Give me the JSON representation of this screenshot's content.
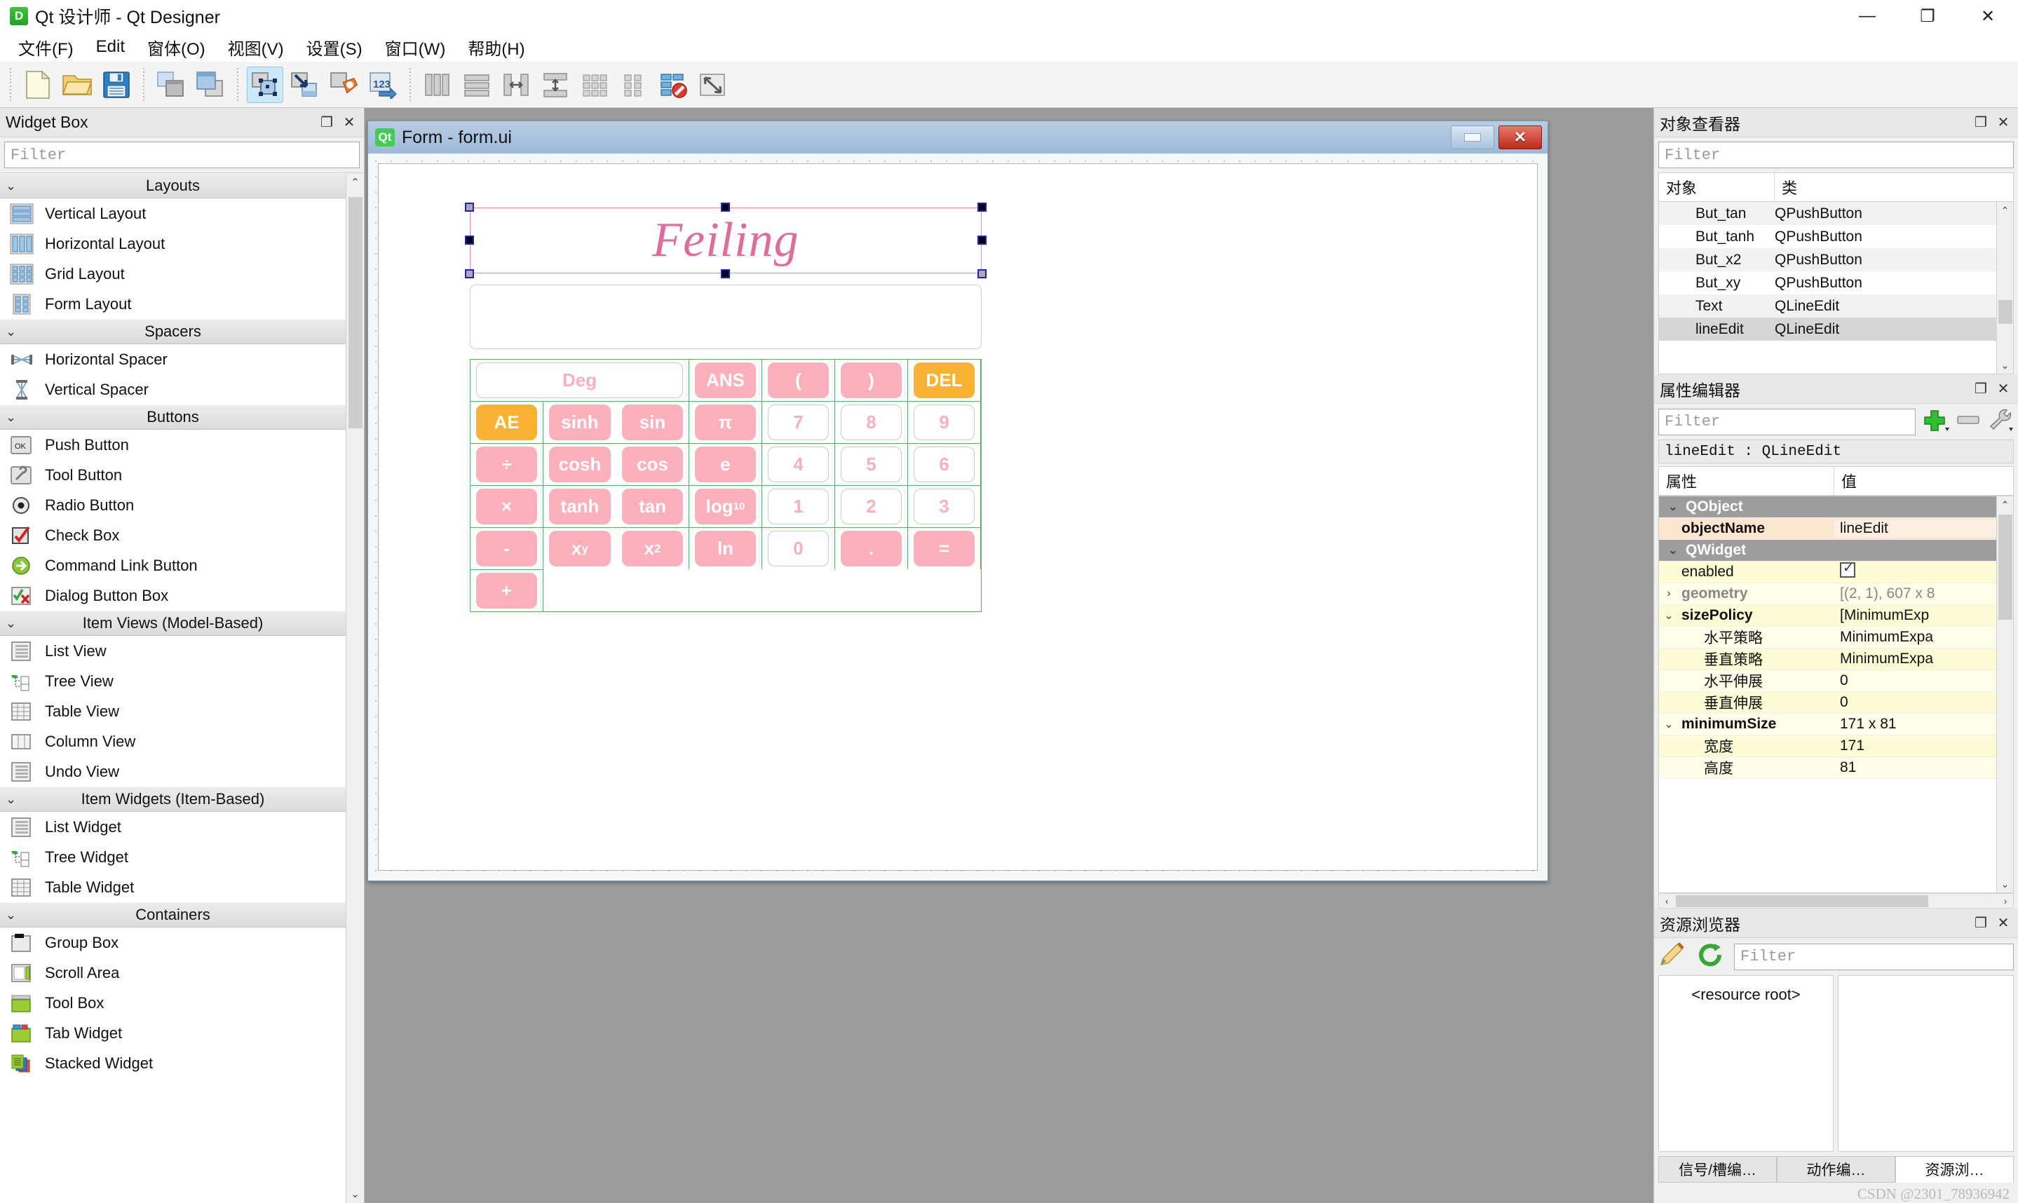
{
  "window": {
    "app_icon_letter": "D",
    "title": "Qt 设计师 - Qt Designer",
    "min_label": "—",
    "max_label": "❐",
    "close_label": "✕"
  },
  "menubar": {
    "items": [
      {
        "label": "文件(F)"
      },
      {
        "label": "Edit"
      },
      {
        "label": "窗体(O)"
      },
      {
        "label": "视图(V)"
      },
      {
        "label": "设置(S)"
      },
      {
        "label": "窗口(W)"
      },
      {
        "label": "帮助(H)"
      }
    ]
  },
  "toolbar": {
    "groups": [
      [
        "new-file-icon",
        "open-folder-icon",
        "save-disk-icon"
      ],
      [
        "copy-windows-icon",
        "paste-windows-icon"
      ],
      [
        "edit-widgets-icon",
        "edit-signals-slots-icon",
        "edit-buddies-icon",
        "edit-tab-order-icon"
      ],
      [
        "layout-horizontally-icon",
        "layout-vertically-icon",
        "layout-splitter-h-icon",
        "layout-splitter-v-icon",
        "layout-grid-icon",
        "layout-form-icon",
        "break-layout-icon",
        "adjust-size-icon"
      ]
    ]
  },
  "widget_box": {
    "title": "Widget Box",
    "float_label": "❐",
    "close_label": "✕",
    "filter_placeholder": "Filter",
    "scroll_up": "⌃",
    "scroll_down": "⌄",
    "categories": [
      {
        "name": "Layouts",
        "chevron": "⌄",
        "items": [
          {
            "label": "Vertical Layout",
            "icon": "vertical-layout-icon"
          },
          {
            "label": "Horizontal Layout",
            "icon": "horizontal-layout-icon"
          },
          {
            "label": "Grid Layout",
            "icon": "grid-layout-icon"
          },
          {
            "label": "Form Layout",
            "icon": "form-layout-icon"
          }
        ]
      },
      {
        "name": "Spacers",
        "chevron": "⌄",
        "items": [
          {
            "label": "Horizontal Spacer",
            "icon": "horizontal-spacer-icon"
          },
          {
            "label": "Vertical Spacer",
            "icon": "vertical-spacer-icon"
          }
        ]
      },
      {
        "name": "Buttons",
        "chevron": "⌄",
        "items": [
          {
            "label": "Push Button",
            "icon": "push-button-icon"
          },
          {
            "label": "Tool Button",
            "icon": "tool-button-icon"
          },
          {
            "label": "Radio Button",
            "icon": "radio-button-icon"
          },
          {
            "label": "Check Box",
            "icon": "check-box-icon"
          },
          {
            "label": "Command Link Button",
            "icon": "command-link-button-icon"
          },
          {
            "label": "Dialog Button Box",
            "icon": "dialog-button-box-icon"
          }
        ]
      },
      {
        "name": "Item Views (Model-Based)",
        "chevron": "⌄",
        "items": [
          {
            "label": "List View",
            "icon": "list-view-icon"
          },
          {
            "label": "Tree View",
            "icon": "tree-view-icon"
          },
          {
            "label": "Table View",
            "icon": "table-view-icon"
          },
          {
            "label": "Column View",
            "icon": "column-view-icon"
          },
          {
            "label": "Undo View",
            "icon": "undo-view-icon"
          }
        ]
      },
      {
        "name": "Item Widgets (Item-Based)",
        "chevron": "⌄",
        "items": [
          {
            "label": "List Widget",
            "icon": "list-widget-icon"
          },
          {
            "label": "Tree Widget",
            "icon": "tree-widget-icon"
          },
          {
            "label": "Table Widget",
            "icon": "table-widget-icon"
          }
        ]
      },
      {
        "name": "Containers",
        "chevron": "⌄",
        "items": [
          {
            "label": "Group Box",
            "icon": "group-box-icon"
          },
          {
            "label": "Scroll Area",
            "icon": "scroll-area-icon"
          },
          {
            "label": "Tool Box",
            "icon": "tool-box-icon"
          },
          {
            "label": "Tab Widget",
            "icon": "tab-widget-icon"
          },
          {
            "label": "Stacked Widget",
            "icon": "stacked-widget-icon"
          }
        ]
      }
    ]
  },
  "form_window": {
    "badge": "Qt",
    "title": "Form - form.ui",
    "minimize_label": "",
    "close_label": "✕"
  },
  "calculator": {
    "brand": "Feiling",
    "display_value": "",
    "rows": [
      [
        {
          "label": "Deg",
          "style": "white",
          "span": 3
        },
        {
          "label": "ANS",
          "style": "pink"
        },
        {
          "label": "(",
          "style": "pink"
        },
        {
          "label": ")",
          "style": "pink"
        },
        {
          "label": "DEL",
          "style": "orange"
        },
        {
          "label": "AE",
          "style": "orange"
        }
      ],
      [
        {
          "label": "sinh",
          "style": "pink"
        },
        {
          "label": "sin",
          "style": "pink"
        },
        {
          "label": "π",
          "style": "pink"
        },
        {
          "label": "7",
          "style": "white"
        },
        {
          "label": "8",
          "style": "white"
        },
        {
          "label": "9",
          "style": "white"
        },
        {
          "label": "÷",
          "style": "pink"
        }
      ],
      [
        {
          "label": "cosh",
          "style": "pink"
        },
        {
          "label": "cos",
          "style": "pink"
        },
        {
          "label": "e",
          "style": "pink"
        },
        {
          "label": "4",
          "style": "white"
        },
        {
          "label": "5",
          "style": "white"
        },
        {
          "label": "6",
          "style": "white"
        },
        {
          "label": "×",
          "style": "pink"
        }
      ],
      [
        {
          "label": "tanh",
          "style": "pink"
        },
        {
          "label": "tan",
          "style": "pink"
        },
        {
          "label": "log",
          "sub": "10",
          "style": "pink"
        },
        {
          "label": "1",
          "style": "white"
        },
        {
          "label": "2",
          "style": "white"
        },
        {
          "label": "3",
          "style": "white"
        },
        {
          "label": "-",
          "style": "pink"
        }
      ],
      [
        {
          "label": "x",
          "sup": "y",
          "style": "pink"
        },
        {
          "label": "x",
          "sup": "2",
          "style": "pink"
        },
        {
          "label": "ln",
          "style": "pink"
        },
        {
          "label": "0",
          "style": "white"
        },
        {
          "label": ".",
          "style": "pink"
        },
        {
          "label": "=",
          "style": "pink"
        },
        {
          "label": "+",
          "style": "pink"
        }
      ]
    ]
  },
  "object_inspector": {
    "title": "对象查看器",
    "float_label": "❐",
    "close_label": "✕",
    "filter_placeholder": "Filter",
    "columns": [
      "对象",
      "类"
    ],
    "rows": [
      {
        "object": "But_tan",
        "class": "QPushButton"
      },
      {
        "object": "But_tanh",
        "class": "QPushButton"
      },
      {
        "object": "But_x2",
        "class": "QPushButton"
      },
      {
        "object": "But_xy",
        "class": "QPushButton"
      },
      {
        "object": "Text",
        "class": "QLineEdit"
      },
      {
        "object": "lineEdit",
        "class": "QLineEdit"
      }
    ],
    "selected_index": 5,
    "scroll_up": "⌃",
    "scroll_down": "⌄"
  },
  "property_editor": {
    "title": "属性编辑器",
    "float_label": "❐",
    "close_label": "✕",
    "filter_placeholder": "Filter",
    "add_icon": "plus-icon",
    "remove_icon": "minus-icon",
    "configure_icon": "wrench-icon",
    "object_line": "lineEdit : QLineEdit",
    "columns": [
      "属性",
      "值"
    ],
    "rows": [
      {
        "kind": "group",
        "name": "QObject",
        "value": "",
        "chevron": "⌄"
      },
      {
        "kind": "name",
        "name": "objectName",
        "value": "lineEdit",
        "indent": 1
      },
      {
        "kind": "group",
        "name": "QWidget",
        "value": "",
        "chevron": "⌄"
      },
      {
        "kind": "y",
        "name": "enabled",
        "value": "",
        "indent": 1,
        "checkbox": true
      },
      {
        "kind": "y2",
        "name": "geometry",
        "value": "[(2, 1), 607 x 8",
        "chevron": "›",
        "bold": true,
        "dim": true
      },
      {
        "kind": "y",
        "name": "sizePolicy",
        "value": "[MinimumExp",
        "chevron": "⌄",
        "bold": true
      },
      {
        "kind": "y2",
        "name": "水平策略",
        "value": "MinimumExpa",
        "indent": 2
      },
      {
        "kind": "y",
        "name": "垂直策略",
        "value": "MinimumExpa",
        "indent": 2
      },
      {
        "kind": "y2",
        "name": "水平伸展",
        "value": "0",
        "indent": 2
      },
      {
        "kind": "y",
        "name": "垂直伸展",
        "value": "0",
        "indent": 2
      },
      {
        "kind": "y2",
        "name": "minimumSize",
        "value": "171 x 81",
        "chevron": "⌄",
        "bold": true
      },
      {
        "kind": "y",
        "name": "宽度",
        "value": "171",
        "indent": 2
      },
      {
        "kind": "y2",
        "name": "高度",
        "value": "81",
        "indent": 2
      }
    ],
    "scroll_up": "⌃",
    "scroll_down": "⌄",
    "hscroll_left": "‹",
    "hscroll_right": "›"
  },
  "resource_browser": {
    "title": "资源浏览器",
    "float_label": "❐",
    "close_label": "✕",
    "edit_icon": "pencil-icon",
    "reload_icon": "reload-icon",
    "filter_placeholder": "Filter",
    "tree_root": "<resource root>",
    "tabs": [
      {
        "label": "信号/槽编…",
        "active": false
      },
      {
        "label": "动作编…",
        "active": false
      },
      {
        "label": "资源浏…",
        "active": true
      }
    ]
  },
  "watermark": "CSDN @2301_78936942",
  "colors": {
    "pink_button": "#fcb0bc",
    "orange_button": "#f9b233",
    "brand_pink": "#dd6d9a",
    "grid_green": "#5fae5f",
    "selection_red": "#f08f8f",
    "accent_blue": "#cde8fb"
  }
}
